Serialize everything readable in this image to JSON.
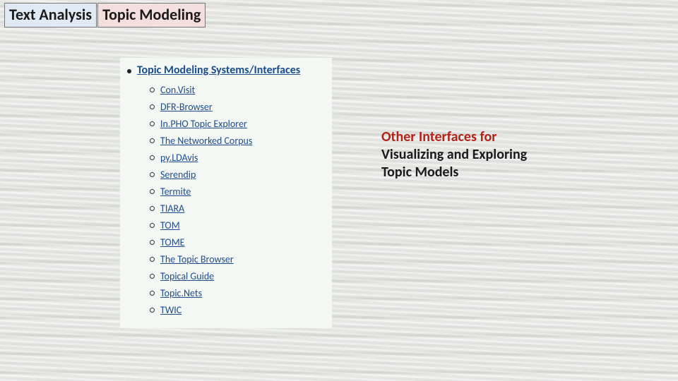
{
  "header": {
    "left": "Text Analysis",
    "right": "Topic Modeling"
  },
  "list": {
    "title": "Topic Modeling Systems/Interfaces",
    "items": [
      "Con.Visit",
      "DFR-Browser",
      "In.PHO Topic Explorer",
      "The Networked Corpus",
      "py.LDAvis",
      "Serendip",
      "Termite",
      "TIARA",
      "TOM",
      "TOME",
      "The Topic Browser",
      "Topical Guide",
      "Topic.Nets",
      "TWIC"
    ]
  },
  "side_heading": {
    "line1": "Other Interfaces for",
    "line2": "Visualizing and Exploring",
    "line3": "Topic Models"
  }
}
